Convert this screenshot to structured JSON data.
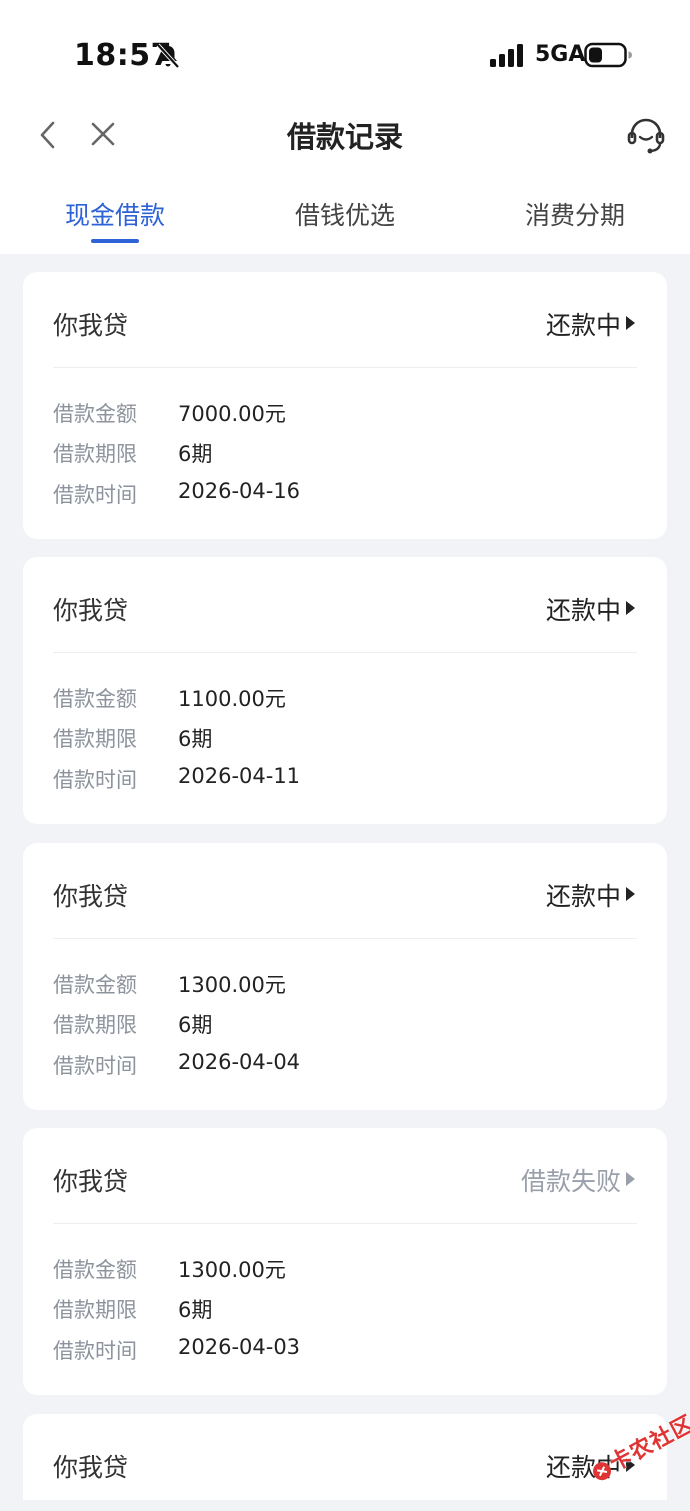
{
  "status_bar": {
    "time": "18:57",
    "network": "5GA",
    "icons": [
      "bell-muted-icon",
      "signal-icon",
      "battery-icon"
    ]
  },
  "nav": {
    "title": "借款记录",
    "icons": [
      "back-icon",
      "close-icon",
      "customer-service-icon"
    ]
  },
  "tabs": [
    {
      "label": "现金借款",
      "active": true
    },
    {
      "label": "借钱优选",
      "active": false
    },
    {
      "label": "消费分期",
      "active": false
    }
  ],
  "labels": {
    "amount": "借款金额",
    "term": "借款期限",
    "time": "借款时间"
  },
  "records": [
    {
      "name": "你我贷",
      "status": "还款中",
      "amount": "7000.00元",
      "term": "6期",
      "date": "2026-04-16"
    },
    {
      "name": "你我贷",
      "status": "还款中",
      "amount": "1100.00元",
      "term": "6期",
      "date": "2026-04-11"
    },
    {
      "name": "你我贷",
      "status": "还款中",
      "amount": "1300.00元",
      "term": "6期",
      "date": "2026-04-04"
    },
    {
      "name": "你我贷",
      "status": "借款失败",
      "amount": "1300.00元",
      "term": "6期",
      "date": "2026-04-03"
    },
    {
      "name": "你我贷",
      "status": "还款中"
    }
  ],
  "watermark": "卡农社区",
  "colors": {
    "accent": "#2e63d8",
    "background": "#f1f3f7",
    "muted_status": "#9aa0aa",
    "watermark": "#e03333"
  }
}
